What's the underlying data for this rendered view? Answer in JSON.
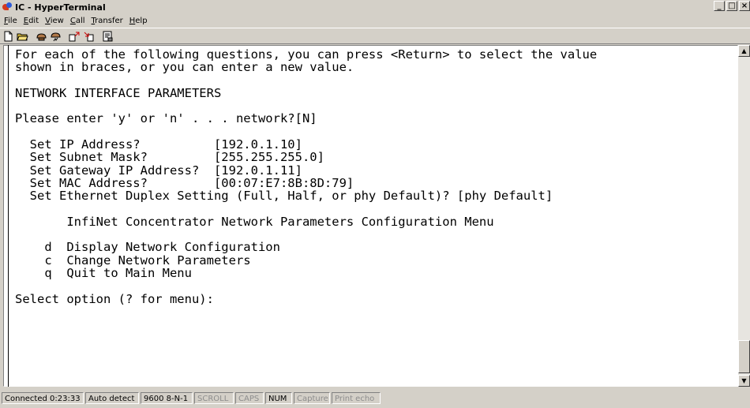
{
  "window": {
    "title": "IC - HyperTerminal",
    "minimize": "_",
    "maximize": "□",
    "close": "×"
  },
  "menu": [
    {
      "u": "F",
      "rest": "ile"
    },
    {
      "u": "E",
      "rest": "dit"
    },
    {
      "u": "V",
      "rest": "iew"
    },
    {
      "u": "C",
      "rest": "all"
    },
    {
      "u": "T",
      "rest": "ransfer"
    },
    {
      "u": "H",
      "rest": "elp"
    }
  ],
  "toolbar": {
    "icons": [
      "new-file-icon",
      "open-folder-icon",
      "call-icon",
      "disconnect-icon",
      "send-icon",
      "receive-icon",
      "properties-icon"
    ]
  },
  "terminal": {
    "lines": [
      "For each of the following questions, you can press <Return> to select the value",
      "shown in braces, or you can enter a new value.",
      "",
      "NETWORK INTERFACE PARAMETERS",
      "",
      "Please enter 'y' or 'n' . . . network?[N]",
      "",
      "  Set IP Address?          [192.0.1.10]",
      "  Set Subnet Mask?         [255.255.255.0]",
      "  Set Gateway IP Address?  [192.0.1.11]",
      "  Set MAC Address?         [00:07:E7:8B:8D:79]",
      "  Set Ethernet Duplex Setting (Full, Half, or phy Default)? [phy Default]",
      "",
      "       InfiNet Concentrator Network Parameters Configuration Menu",
      "",
      "    d  Display Network Configuration",
      "    c  Change Network Parameters",
      "    q  Quit to Main Menu",
      "",
      "Select option (? for menu):"
    ]
  },
  "status": {
    "connected": "Connected 0:23:33",
    "detect": "Auto detect",
    "settings": "9600 8-N-1",
    "scroll": "SCROLL",
    "caps": "CAPS",
    "num": "NUM",
    "capture": "Capture",
    "print_echo": "Print echo"
  }
}
